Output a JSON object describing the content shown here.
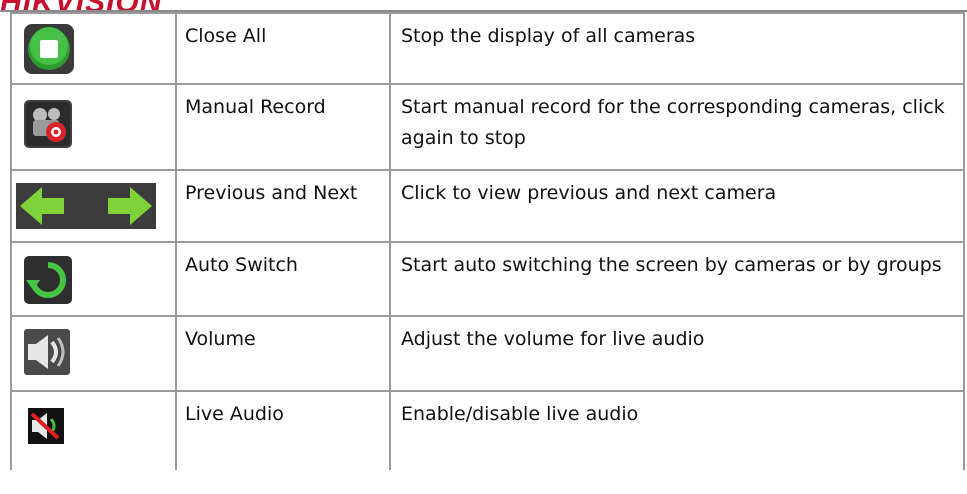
{
  "brand": {
    "text": "HIKVISION"
  },
  "rows": [
    {
      "icon": "stop-icon",
      "name": "Close All",
      "desc": "Stop the display of all cameras"
    },
    {
      "icon": "manual-record-icon",
      "name": "Manual Record",
      "desc": "Start manual record for the corresponding cameras, click again to stop"
    },
    {
      "icon": "previous-next-arrows-icon",
      "name": "Previous and Next",
      "desc": "Click to view previous and next camera"
    },
    {
      "icon": "auto-switch-icon",
      "name": "Auto Switch",
      "desc": "Start auto switching the screen by cameras or by groups"
    },
    {
      "icon": "volume-icon",
      "name": "Volume",
      "desc": "Adjust the volume for live audio"
    },
    {
      "icon": "live-audio-mute-icon",
      "name": "Live Audio",
      "desc": "Enable/disable live audio"
    }
  ]
}
